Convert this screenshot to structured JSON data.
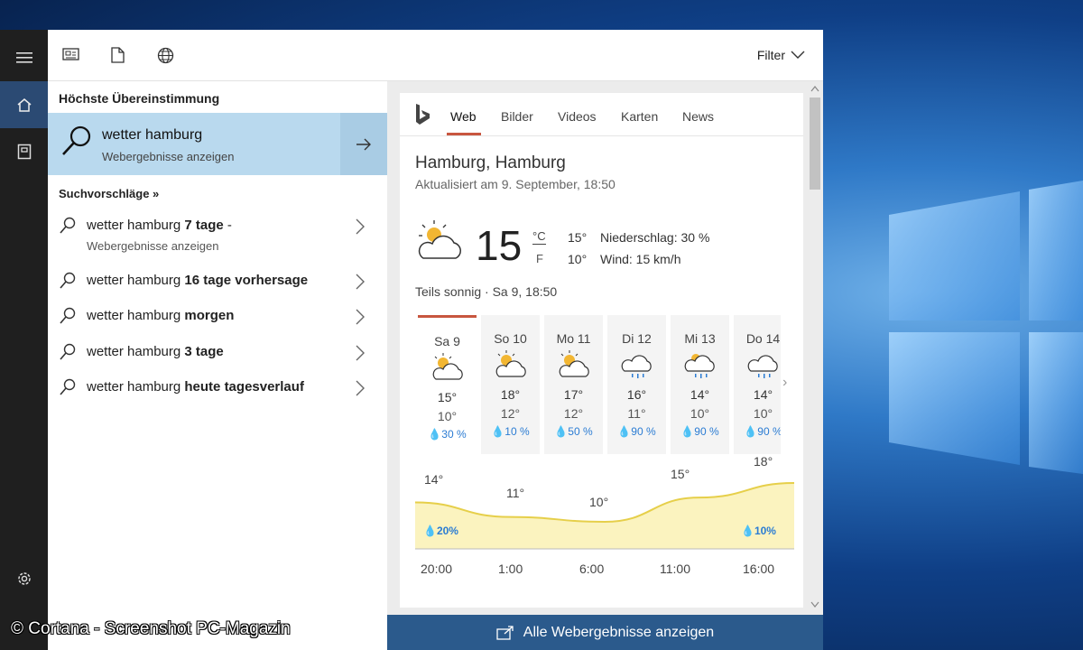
{
  "topbar": {
    "filter_label": "Filter",
    "icons": [
      "news-icon",
      "document-icon",
      "globe-icon"
    ]
  },
  "rail": {
    "icons": [
      "hamburger-menu-icon",
      "home-icon",
      "notebook-icon",
      "settings-icon"
    ]
  },
  "best_match": {
    "heading": "Höchste Übereinstimmung",
    "title": "wetter hamburg",
    "subtitle": "Webergebnisse anzeigen"
  },
  "suggestions": {
    "heading": "Suchvorschläge »",
    "items": [
      {
        "prefix": "wetter hamburg ",
        "bold": "7 tage",
        "suffix": " -",
        "sub": "Webergebnisse anzeigen"
      },
      {
        "prefix": "wetter hamburg ",
        "bold": "16 tage vorhersage",
        "suffix": "",
        "sub": ""
      },
      {
        "prefix": "wetter hamburg ",
        "bold": "morgen",
        "suffix": "",
        "sub": ""
      },
      {
        "prefix": "wetter hamburg ",
        "bold": "3 tage",
        "suffix": "",
        "sub": ""
      },
      {
        "prefix": "wetter hamburg ",
        "bold": "heute tagesverlauf",
        "suffix": "",
        "sub": ""
      }
    ]
  },
  "tabs": [
    "Web",
    "Bilder",
    "Videos",
    "Karten",
    "News"
  ],
  "weather": {
    "city": "Hamburg, Hamburg",
    "updated": "Aktualisiert am 9. September, 18:50",
    "temp": "15",
    "unit_c": "°C",
    "unit_f": "F",
    "high": "15°",
    "low": "10°",
    "precip": "Niederschlag: 30 %",
    "wind": "Wind: 15 km/h",
    "condition": "Teils sonnig · Sa 9, 18:50"
  },
  "forecast": [
    {
      "day": "Sa 9",
      "high": "15°",
      "low": "10°",
      "precip": "30 %",
      "icon": "partly-sunny-icon"
    },
    {
      "day": "So 10",
      "high": "18°",
      "low": "12°",
      "precip": "10 %",
      "icon": "partly-sunny-icon"
    },
    {
      "day": "Mo 11",
      "high": "17°",
      "low": "12°",
      "precip": "50 %",
      "icon": "partly-sunny-icon"
    },
    {
      "day": "Di 12",
      "high": "16°",
      "low": "11°",
      "precip": "90 %",
      "icon": "rain-cloud-icon"
    },
    {
      "day": "Mi 13",
      "high": "14°",
      "low": "10°",
      "precip": "90 %",
      "icon": "sun-rain-icon"
    },
    {
      "day": "Do 14",
      "high": "14°",
      "low": "10°",
      "precip": "90 %",
      "icon": "rain-cloud-icon"
    }
  ],
  "hourly": {
    "labels": [
      "14°",
      "11°",
      "10°",
      "15°",
      "18°"
    ],
    "precip_left": "20%",
    "precip_right": "10%",
    "times": [
      "20:00",
      "1:00",
      "6:00",
      "11:00",
      "16:00"
    ]
  },
  "chart_data": {
    "type": "area",
    "x": [
      "20:00",
      "1:00",
      "6:00",
      "11:00",
      "16:00"
    ],
    "series": [
      {
        "values": [
          14,
          11,
          10,
          15,
          18
        ]
      }
    ]
  },
  "bottom": {
    "label": "Alle Webergebnisse anzeigen"
  },
  "watermark": "© Cortana - Screenshot PC-Magazin"
}
